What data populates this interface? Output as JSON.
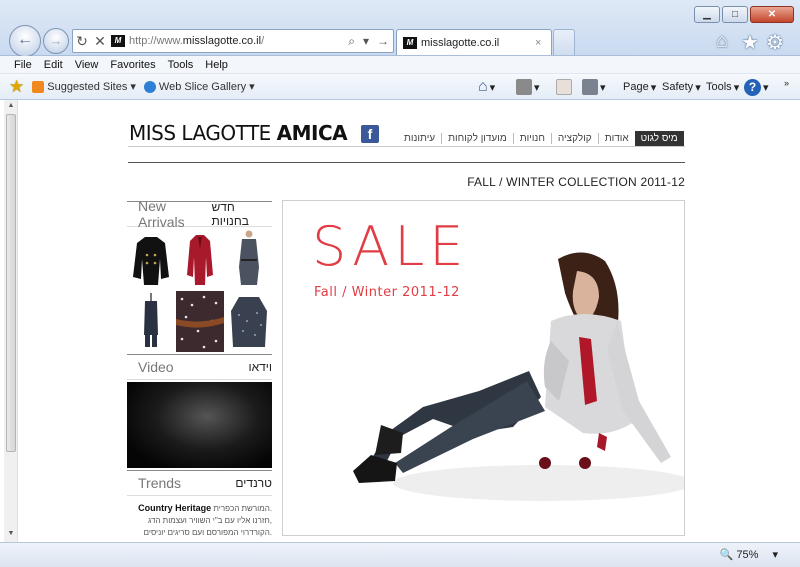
{
  "window": {
    "minimize": "▁",
    "maximize": "□",
    "close": "✕"
  },
  "addressbar": {
    "url_prefix": "http://www.",
    "url_domain": "misslagotte.co.il",
    "url_suffix": "/",
    "search_icon": "⌕"
  },
  "tab": {
    "title": "misslagotte.co.il",
    "close": "×"
  },
  "menubar": [
    "File",
    "Edit",
    "View",
    "Favorites",
    "Tools",
    "Help"
  ],
  "favorites": {
    "suggested_sites": "Suggested Sites",
    "web_slice_gallery": "Web Slice Gallery"
  },
  "commandbar": {
    "page": "Page",
    "safety": "Safety",
    "tools": "Tools"
  },
  "site": {
    "logo_part1": "MISS LAGOTTE",
    "logo_part2": "AMICA",
    "facebook": "f",
    "nav": [
      "מיס לגוט",
      "אודות",
      "קולקציה",
      "חנויות",
      "מועדון לקוחות",
      "עיתונות"
    ],
    "collection_title": "FALL / WINTER COLLECTION 2011-12",
    "new_arrivals_en": "New Arrivals",
    "new_arrivals_he": "חדש בחנויות",
    "video_en": "Video",
    "video_he": "וידאו",
    "trends_en": "Trends",
    "trends_he": "טרנדים",
    "trend_title": "Country Heritage",
    "trend_line1": "המורשת הכפרית.",
    "trend_line2": "חזרנו אליו עם ב\"י השוויר ועצמות הדג,",
    "trend_line3": "הקורדרוי המפורסם ועם סריגים יוניסים.",
    "sale": "SALE",
    "sale_sub": "Fall / Winter 2011-12"
  },
  "status": {
    "zoom": "75%"
  },
  "colors": {
    "sale_red": "#e23d45",
    "facebook_blue": "#3b5998"
  }
}
